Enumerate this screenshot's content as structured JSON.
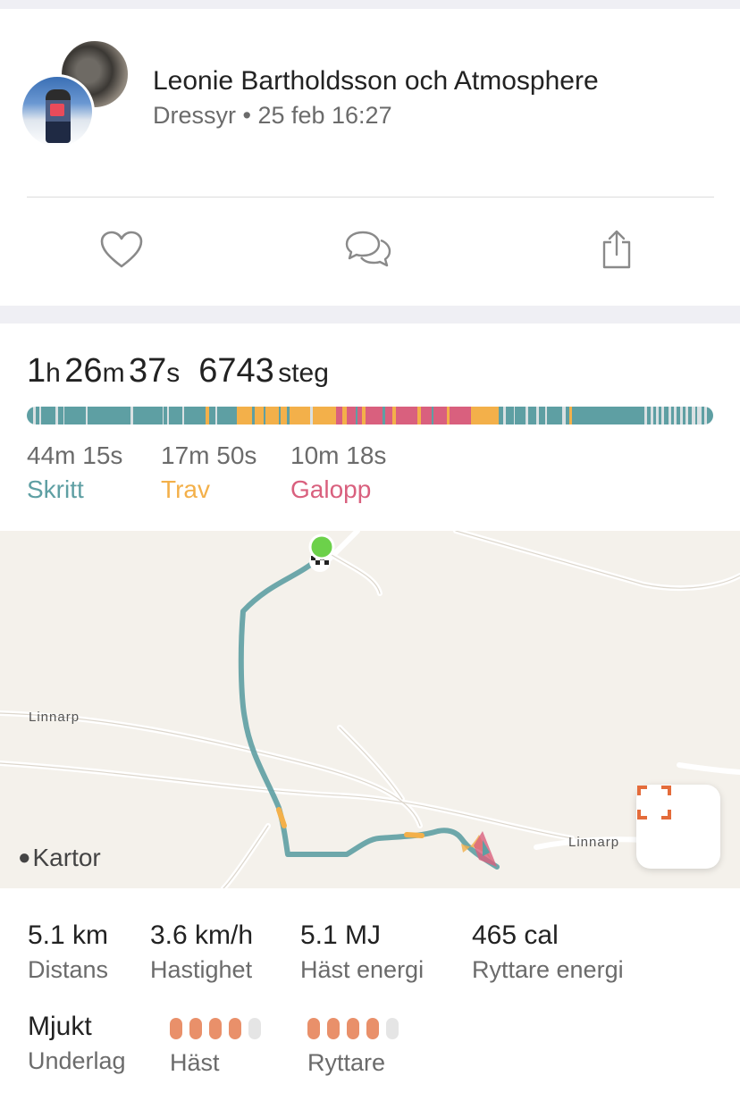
{
  "post": {
    "title": "Leonie Bartholdsson och Atmosphere",
    "subtitle": "Dressyr • 25 feb 16:27",
    "actions": [
      {
        "name": "like",
        "icon": "heart-icon"
      },
      {
        "name": "comment",
        "icon": "comment-bubbles-icon"
      },
      {
        "name": "share",
        "icon": "share-icon"
      }
    ]
  },
  "summary": {
    "h": "1",
    "h_unit": "h",
    "m": "26",
    "m_unit": "m",
    "s": "37",
    "s_unit": "s",
    "steps": "6743",
    "steps_unit": "steg"
  },
  "gaits": [
    {
      "time": "44m 15s",
      "name": "Skritt",
      "color": "#5e9fa3"
    },
    {
      "time": "17m 50s",
      "name": "Trav",
      "color": "#f3b04a"
    },
    {
      "time": "10m 18s",
      "name": "Galopp",
      "color": "#d9607e"
    }
  ],
  "gait_timeline": {
    "description_colors": {
      "walk": "#5e9fa3",
      "trot": "#f3b04a",
      "canter": "#d9607e",
      "pause": "#d9e0e2"
    }
  },
  "map": {
    "labels": [
      "Linnarp",
      "Linnarp"
    ],
    "brand": "Kartor",
    "expand_icon": "expand-icon"
  },
  "stats": [
    {
      "value": "5.1 km",
      "label": "Distans"
    },
    {
      "value": "3.6 km/h",
      "label": "Hastighet"
    },
    {
      "value": "5.1 MJ",
      "label": "Häst energi"
    },
    {
      "value": "465 cal",
      "label": "Ryttare energi"
    }
  ],
  "ground": {
    "value": "Mjukt",
    "label": "Underlag"
  },
  "ratings": [
    {
      "label": "Häst",
      "score": 4,
      "max": 5
    },
    {
      "label": "Ryttare",
      "score": 4,
      "max": 5
    }
  ]
}
